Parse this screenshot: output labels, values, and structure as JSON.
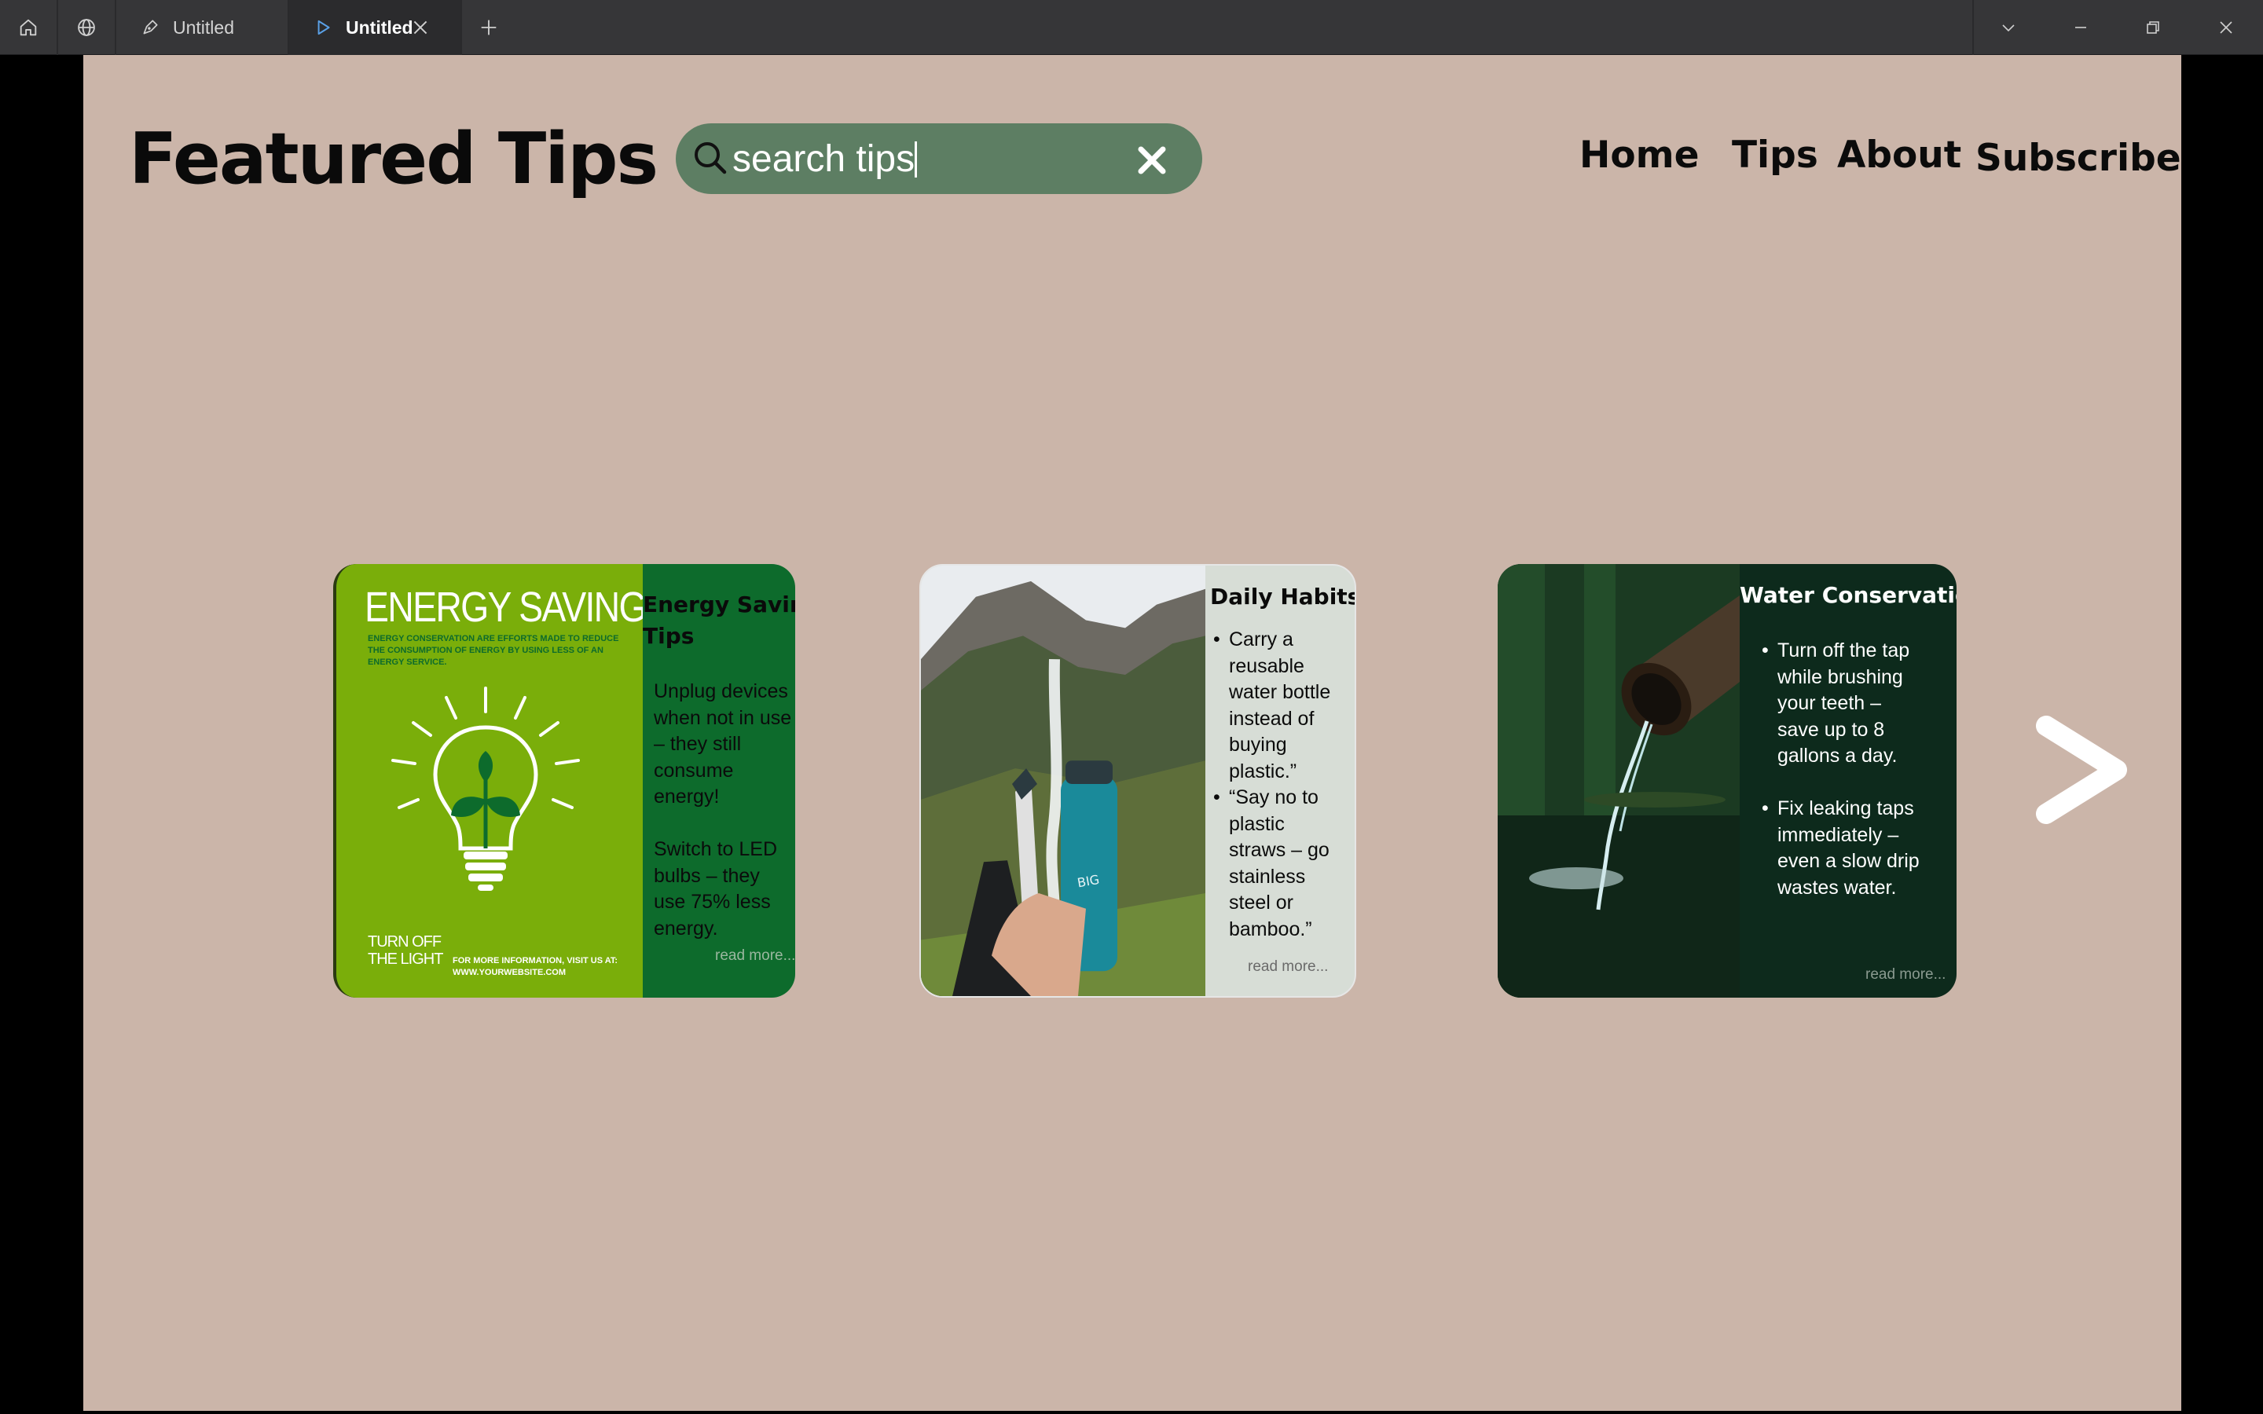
{
  "titlebar": {
    "tabs": [
      {
        "label": "Untitled"
      },
      {
        "label": "Untitled"
      }
    ]
  },
  "page": {
    "title": "Featured Tips",
    "search": {
      "value": "search tips"
    },
    "nav": [
      "Home",
      "Tips",
      "About",
      "Subscribe"
    ]
  },
  "cards": [
    {
      "poster": {
        "headline": "ENERGY SAVING",
        "subline": "ENERGY CONSERVATION ARE EFFORTS MADE TO REDUCE THE CONSUMPTION OF ENERGY BY USING LESS OF AN ENERGY SERVICE.",
        "footer_left_1": "TURN OFF",
        "footer_left_2": "THE LIGHT",
        "footer_right_1": "FOR MORE INFORMATION, VISIT US AT:",
        "footer_right_2": "WWW.YOURWEBSITE.COM"
      },
      "title_1": "Energy Saving",
      "title_2": "Tips",
      "lines": [
        "Unplug devices",
        "when not in use",
        "– they still",
        "consume",
        "energy!",
        "",
        "Switch to LED",
        "bulbs – they",
        "use 75% less",
        "energy."
      ],
      "read_more": "read more...",
      "accent": "#0d6b2c"
    },
    {
      "title": "Daily Habits",
      "items": [
        [
          "Carry a",
          "reusable",
          "water bottle",
          "instead of",
          "buying",
          "plastic.”"
        ],
        [
          "“Say no to",
          "plastic",
          "straws – go",
          "stainless",
          "steel or",
          "bamboo.”"
        ]
      ],
      "read_more": "read more...",
      "accent": "#d7ddd6"
    },
    {
      "title": "Water Conservation",
      "items": [
        [
          "Turn off the tap",
          "while brushing",
          "your teeth –",
          "save up to 8",
          "gallons a day."
        ],
        [
          "Fix leaking taps",
          "immediately –",
          "even a slow drip",
          "wastes water."
        ]
      ],
      "read_more": "read more...",
      "accent": "#0d2a1c"
    }
  ],
  "colors": {
    "background": "#cbb5a9",
    "search": "#5d7e63",
    "poster_green": "#7aae0a"
  }
}
